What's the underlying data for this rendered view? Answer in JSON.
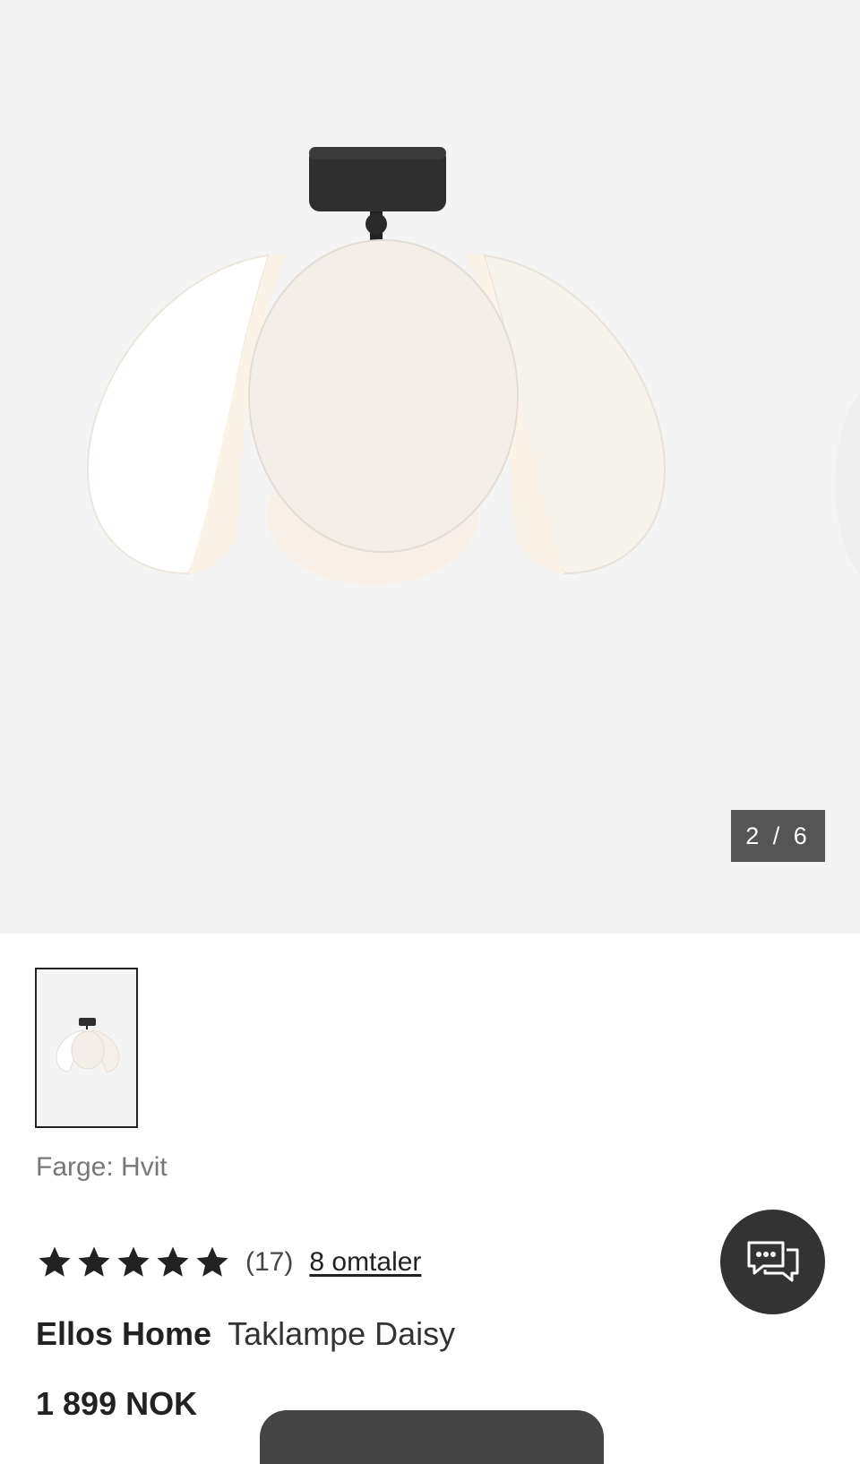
{
  "gallery": {
    "counter": "2 / 6",
    "background": "#f4f4f4"
  },
  "product": {
    "color_label": "Farge: Hvit",
    "rating": 5,
    "rating_count": "(17)",
    "reviews_link": "8 omtaler",
    "brand": "Ellos Home",
    "name": "Taklampe Daisy",
    "price": "1 899 NOK"
  },
  "icons": {
    "star": "star-icon",
    "chat": "chat-icon"
  },
  "colors": {
    "counter_bg": "#555555",
    "chat_bg": "#333333",
    "text": "#222222",
    "muted": "#777777"
  }
}
